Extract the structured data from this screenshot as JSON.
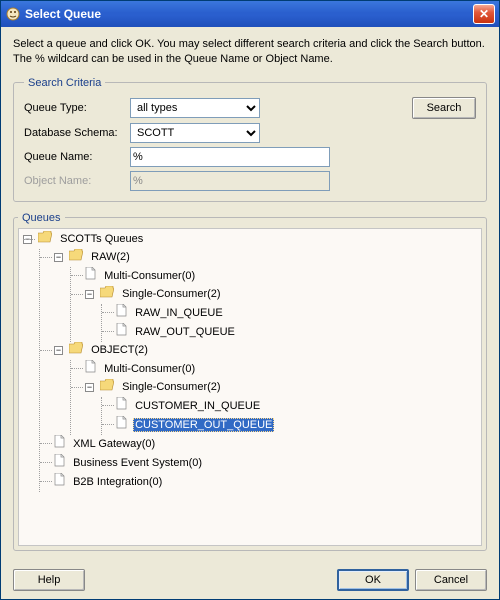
{
  "window": {
    "title": "Select Queue"
  },
  "instructions": "Select a queue and click OK. You may select different search criteria and click the Search button. The % wildcard can be used in the Queue Name or Object Name.",
  "criteria": {
    "legend": "Search Criteria",
    "queue_type_label": "Queue Type:",
    "queue_type_value": "all types",
    "db_schema_label": "Database Schema:",
    "db_schema_value": "SCOTT",
    "queue_name_label": "Queue Name:",
    "queue_name_value": "%",
    "object_name_label": "Object Name:",
    "object_name_value": "%",
    "search_label": "Search"
  },
  "queues": {
    "legend": "Queues",
    "root": "SCOTTs Queues",
    "raw": "RAW(2)",
    "raw_multi": "Multi-Consumer(0)",
    "raw_single": "Single-Consumer(2)",
    "raw_in": "RAW_IN_QUEUE",
    "raw_out": "RAW_OUT_QUEUE",
    "object": "OBJECT(2)",
    "obj_multi": "Multi-Consumer(0)",
    "obj_single": "Single-Consumer(2)",
    "cust_in": "CUSTOMER_IN_QUEUE",
    "cust_out": "CUSTOMER_OUT_QUEUE",
    "xml_gateway": "XML Gateway(0)",
    "bes": "Business Event System(0)",
    "b2b": "B2B Integration(0)"
  },
  "buttons": {
    "help": "Help",
    "ok": "OK",
    "cancel": "Cancel"
  },
  "expander": {
    "minus": "−",
    "plus": "+"
  }
}
